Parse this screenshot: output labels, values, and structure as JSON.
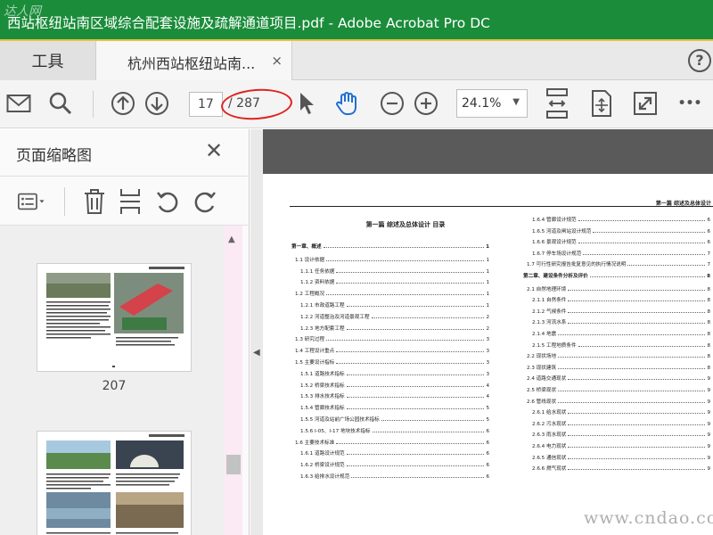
{
  "window": {
    "title": "西站枢纽站南区域综合配套设施及疏解通道项目.pdf - Adobe Acrobat Pro DC",
    "watermark_top_left": "达人网"
  },
  "tabs": {
    "tools_label": "工具",
    "doc_label": "杭州西站枢纽站南...",
    "close_glyph": "×",
    "help_glyph": "?"
  },
  "toolbar": {
    "icons": [
      "mail-icon",
      "search-icon",
      "arrow-up-icon",
      "arrow-down-icon",
      "select-cursor-icon",
      "hand-tool-icon",
      "zoom-out-icon",
      "zoom-in-icon",
      "fit-page-icon",
      "scroll-mode-icon",
      "fullscreen-icon",
      "more-icon"
    ],
    "current_page": "17",
    "total_pages": "/ 287",
    "zoom": "24.1%",
    "more_glyph": "•••",
    "annotation_color": "#e0231f"
  },
  "sidebar": {
    "title": "页面缩略图",
    "close_glyph": "✕",
    "tools": [
      "options-icon",
      "delete-icon",
      "insert-page-icon",
      "rotate-ccw-icon",
      "rotate-cw-icon"
    ],
    "thumbnails": [
      {
        "label": "207"
      },
      {
        "label": ""
      }
    ]
  },
  "document": {
    "header": "第一篇 综述及总体设计",
    "toc_title": "第一篇 综述及总体设计 目录",
    "left_column": [
      {
        "text": "第一章、概述",
        "page": "1",
        "bold": true
      },
      {
        "text": "1.1 设计依据",
        "page": "1"
      },
      {
        "text": "1.1.1 任务依据",
        "page": "1"
      },
      {
        "text": "1.1.2 资料依据",
        "page": "1"
      },
      {
        "text": "1.2 工程概况",
        "page": "1"
      },
      {
        "text": "1.2.1 市政道路工程",
        "page": "1"
      },
      {
        "text": "1.2.2 河道整治及河道景观工程",
        "page": "2"
      },
      {
        "text": "1.2.3 地方配套工程",
        "page": "2"
      },
      {
        "text": "1.3 研究过程",
        "page": "3"
      },
      {
        "text": "1.4 工程设计重点",
        "page": "3"
      },
      {
        "text": "1.5 主要设计指标",
        "page": "3"
      },
      {
        "text": "1.5.1 道路技术指标",
        "page": "3"
      },
      {
        "text": "1.5.2 桥梁技术指标",
        "page": "4"
      },
      {
        "text": "1.5.3 排水技术指标",
        "page": "4"
      },
      {
        "text": "1.5.4 管廊技术指标",
        "page": "5"
      },
      {
        "text": "1.5.5 河道及站前广场公园技术指标",
        "page": "5"
      },
      {
        "text": "1.5.6 I-05、I-17 地块技术指标",
        "page": "6"
      },
      {
        "text": "1.6 主要技术标准",
        "page": "6"
      },
      {
        "text": "1.6.1 道路设计规范",
        "page": "6"
      },
      {
        "text": "1.6.2 桥梁设计规范",
        "page": "6"
      },
      {
        "text": "1.6.3 给排水设计规范",
        "page": "6"
      }
    ],
    "right_column": [
      {
        "text": "1.6.4 管廊设计规范",
        "page": "6"
      },
      {
        "text": "1.6.5 河道及闸站设计规范",
        "page": "6"
      },
      {
        "text": "1.6.6 景观设计规范",
        "page": "6"
      },
      {
        "text": "1.6.7 停车场设计规范",
        "page": "7"
      },
      {
        "text": "1.7 可行性研究报告批复意见的执行情况说明",
        "page": "7"
      },
      {
        "text": "第二章、建设条件分析及评价",
        "page": "8",
        "bold": true
      },
      {
        "text": "2.1 自然地理环境",
        "page": "8"
      },
      {
        "text": "2.1.1 自然条件",
        "page": "8"
      },
      {
        "text": "2.1.2 气候条件",
        "page": "8"
      },
      {
        "text": "2.1.3 河流水系",
        "page": "8"
      },
      {
        "text": "2.1.4 地震",
        "page": "8"
      },
      {
        "text": "2.1.5 工程地质条件",
        "page": "8"
      },
      {
        "text": "2.2 现状场地",
        "page": "8"
      },
      {
        "text": "2.3 现状建筑",
        "page": "8"
      },
      {
        "text": "2.4 道路交通现状",
        "page": "9"
      },
      {
        "text": "2.5 桥梁现状",
        "page": "9"
      },
      {
        "text": "2.6 管线现状",
        "page": "9"
      },
      {
        "text": "2.6.1 给水现状",
        "page": "9"
      },
      {
        "text": "2.6.2 污水现状",
        "page": "9"
      },
      {
        "text": "2.6.3 雨水现状",
        "page": "9"
      },
      {
        "text": "2.6.4 电力现状",
        "page": "9"
      },
      {
        "text": "2.6.5 通信现状",
        "page": "9"
      },
      {
        "text": "2.6.6 燃气现状",
        "page": "9"
      }
    ]
  },
  "watermark_bottom_right": "www.cndao.com",
  "colors": {
    "titlebar": "#1a8c3a",
    "titlebar_border": "#e8c23a",
    "hand_tool": "#1f6fd1"
  }
}
